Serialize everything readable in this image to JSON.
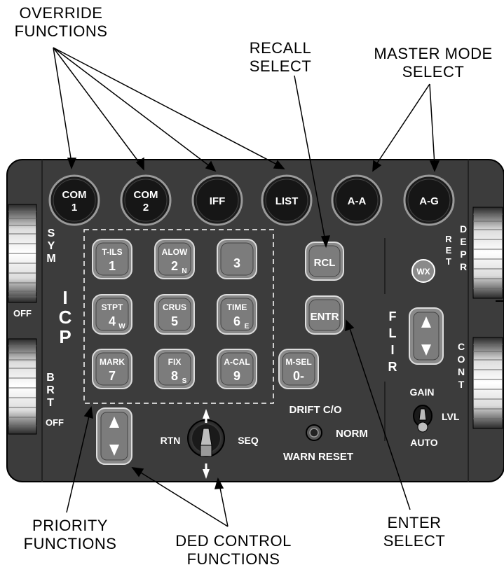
{
  "callouts": {
    "override": [
      "OVERRIDE",
      "FUNCTIONS"
    ],
    "recall": [
      "RECALL",
      "SELECT"
    ],
    "master_mode": [
      "MASTER MODE",
      "SELECT"
    ],
    "priority": [
      "PRIORITY",
      "FUNCTIONS"
    ],
    "ded_control": [
      "DED CONTROL",
      "FUNCTIONS"
    ],
    "enter": [
      "ENTER",
      "SELECT"
    ]
  },
  "top_buttons": [
    {
      "line1": "COM",
      "line2": "1"
    },
    {
      "line1": "COM",
      "line2": "2"
    },
    {
      "line1": "IFF",
      "line2": ""
    },
    {
      "line1": "LIST",
      "line2": ""
    },
    {
      "line1": "A-A",
      "line2": ""
    },
    {
      "line1": "A-G",
      "line2": ""
    }
  ],
  "keypad": [
    {
      "label": "T-ILS",
      "num": "1",
      "sub": ""
    },
    {
      "label": "ALOW",
      "num": "2",
      "sub": "N"
    },
    {
      "label": "",
      "num": "3",
      "sub": ""
    },
    {
      "label": "STPT",
      "num": "4",
      "sub": "W"
    },
    {
      "label": "CRUS",
      "num": "5",
      "sub": ""
    },
    {
      "label": "TIME",
      "num": "6",
      "sub": "E"
    },
    {
      "label": "MARK",
      "num": "7",
      "sub": ""
    },
    {
      "label": "FIX",
      "num": "8",
      "sub": "S"
    },
    {
      "label": "A-CAL",
      "num": "9",
      "sub": ""
    },
    {
      "label": "M-SEL",
      "num": "0-",
      "sub": ""
    }
  ],
  "panel": {
    "rcl": "RCL",
    "entr": "ENTR",
    "wx": "WX",
    "icp": [
      "I",
      "C",
      "P"
    ],
    "sym": [
      "S",
      "Y",
      "M"
    ],
    "brt": [
      "B",
      "R",
      "T"
    ],
    "off_upper": "OFF",
    "off_lower": "OFF",
    "ret": [
      "R",
      "E",
      "T"
    ],
    "depr": [
      "D",
      "E",
      "P",
      "R"
    ],
    "flir": [
      "F",
      "L",
      "I",
      "R"
    ],
    "cont": [
      "C",
      "O",
      "N",
      "T"
    ],
    "gain": "GAIN",
    "lvl": "LVL",
    "auto": "AUTO",
    "rtn": "RTN",
    "seq": "SEQ",
    "drift_co": "DRIFT C/O",
    "norm": "NORM",
    "warn_reset": "WARN RESET"
  },
  "colors": {
    "panel": "#3c3c3c",
    "button_dark": "#1c1c1c",
    "button_light": "#8a8a8a",
    "text_light": "#ffffff"
  }
}
